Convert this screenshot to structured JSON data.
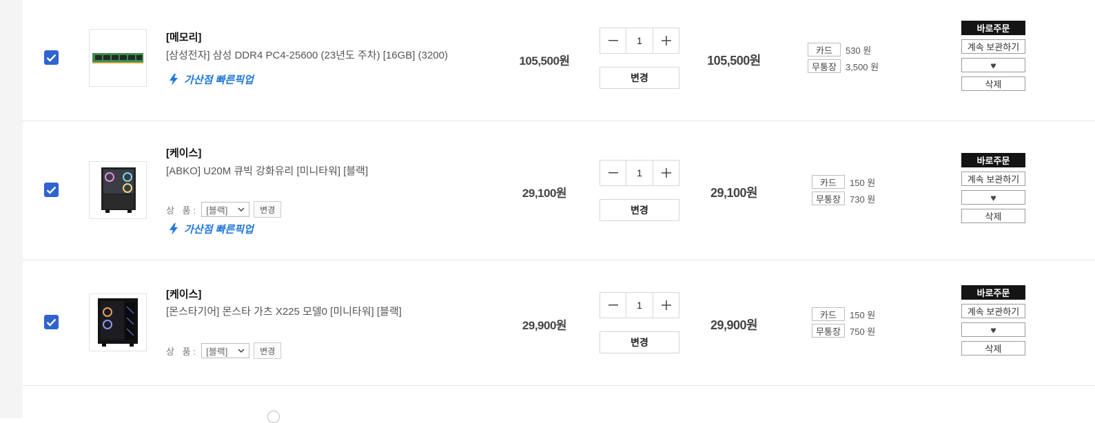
{
  "labels": {
    "option_label": "상 품:",
    "option_change": "변경",
    "qty_change": "변경",
    "pickup": "가산점 빠른픽업",
    "card": "카드",
    "bank": "무통장",
    "order_now": "바로주문",
    "keep": "계속 보관하기",
    "wish": "♥",
    "delete": "삭제"
  },
  "items": [
    {
      "checked": true,
      "category": "[메모리]",
      "name": "[삼성전자] 삼성 DDR4 PC4-25600 (23년도 주차) [16GB] (3200)",
      "unit_price": "105,500원",
      "quantity": "1",
      "total_price": "105,500원",
      "card_points": "530 원",
      "bank_points": "3,500 원",
      "option": null,
      "pickup": true
    },
    {
      "checked": true,
      "category": "[케이스]",
      "name": "[ABKO] U20M 큐빅 강화유리 [미니타워] [블랙]",
      "unit_price": "29,100원",
      "quantity": "1",
      "total_price": "29,100원",
      "card_points": "150 원",
      "bank_points": "730 원",
      "option": "[블랙]",
      "pickup": true
    },
    {
      "checked": true,
      "category": "[케이스]",
      "name": "[몬스타기어] 몬스타 가츠 X225 모델0 [미니타워] [블랙]",
      "unit_price": "29,900원",
      "quantity": "1",
      "total_price": "29,900원",
      "card_points": "150 원",
      "bank_points": "750 원",
      "option": "[블랙]",
      "pickup": false
    }
  ],
  "colors": {
    "checkbox": "#2f63cf",
    "pickup": "#1e77d9",
    "order_button": "#141414"
  }
}
